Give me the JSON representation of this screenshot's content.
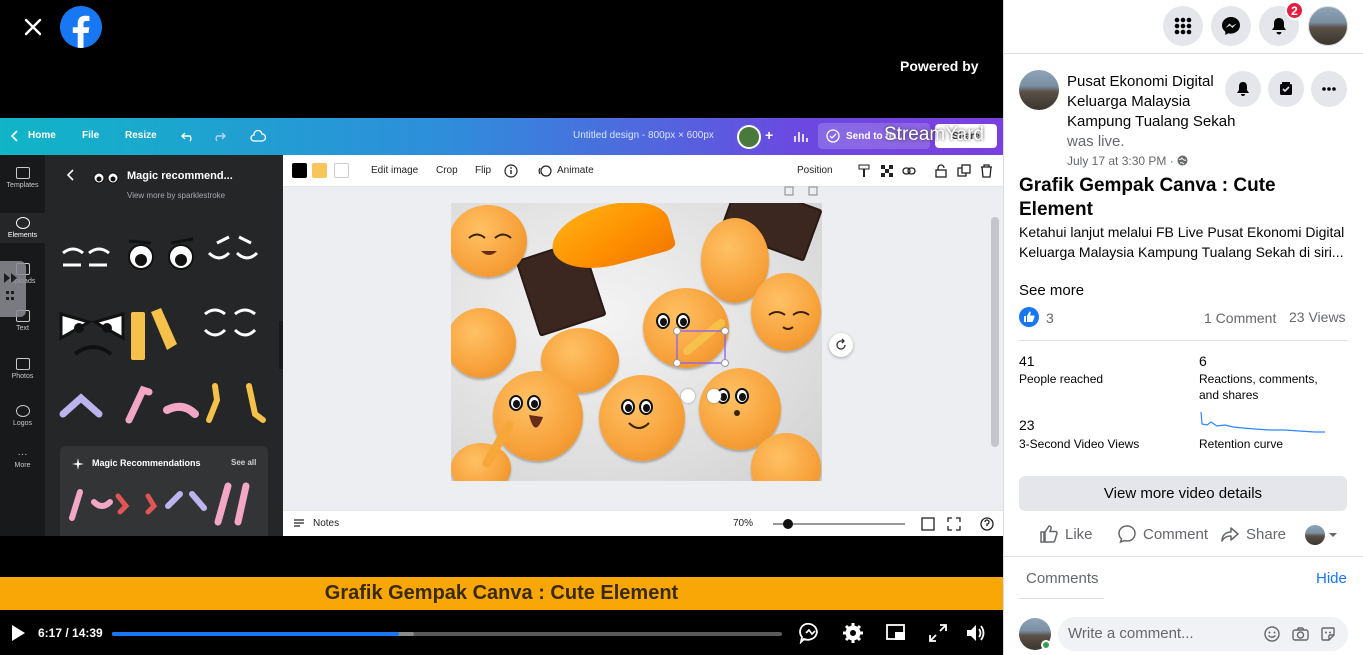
{
  "video": {
    "powered_by": "Powered by",
    "streamyard_label": "StreamYard",
    "caption": "Grafik Gempak Canva : Cute Element",
    "time": "6:17 / 14:39",
    "progress": 0.4288,
    "buffered": 0.45
  },
  "canva": {
    "nav": {
      "home": "Home",
      "file": "File",
      "resize": "Resize"
    },
    "doc_title": "Untitled design - 800px × 600px",
    "send": "Send to te...",
    "share": "Share",
    "rail": [
      "Templates",
      "Elements",
      "Uploads",
      "Text",
      "Photos",
      "Logos",
      "More"
    ],
    "panel": {
      "title": "Magic recommend...",
      "subtitle": "View more by sparklestroke",
      "recs_title": "Magic Recommendations",
      "see_all": "See all"
    },
    "toolbar": {
      "edit_image": "Edit image",
      "crop": "Crop",
      "flip": "Flip",
      "animate": "Animate",
      "position": "Position"
    },
    "colors": [
      "#000000",
      "#f7c55a",
      "#ffffff"
    ],
    "bottom": {
      "notes": "Notes",
      "zoom": "70%"
    }
  },
  "side": {
    "notifications_count": "2",
    "page_name": "Pusat Ekonomi Digital Keluarga Malaysia Kampung Tualang Sekah",
    "was_live": "was live.",
    "date": "July 17 at 3:30 PM · ",
    "post_title": "Grafik Gempak Canva : Cute Element",
    "post_desc": "Ketahui lanjut melalui FB Live Pusat Ekonomi Digital Keluarga Malaysia Kampung Tualang Sekah di siri...",
    "see_more": "See more",
    "reactions": "3",
    "comments_count": "1 Comment",
    "views": "23 Views",
    "stats": [
      {
        "num": "41",
        "label": "People reached"
      },
      {
        "num": "6",
        "label": "Reactions, comments, and shares"
      },
      {
        "num": "23",
        "label": "3-Second Video Views"
      },
      {
        "num": "",
        "label": "Retention curve"
      }
    ],
    "view_more": "View more video details",
    "actions": {
      "like": "Like",
      "comment": "Comment",
      "share": "Share"
    },
    "comments_label": "Comments",
    "hide": "Hide",
    "comment_placeholder": "Write a comment..."
  }
}
